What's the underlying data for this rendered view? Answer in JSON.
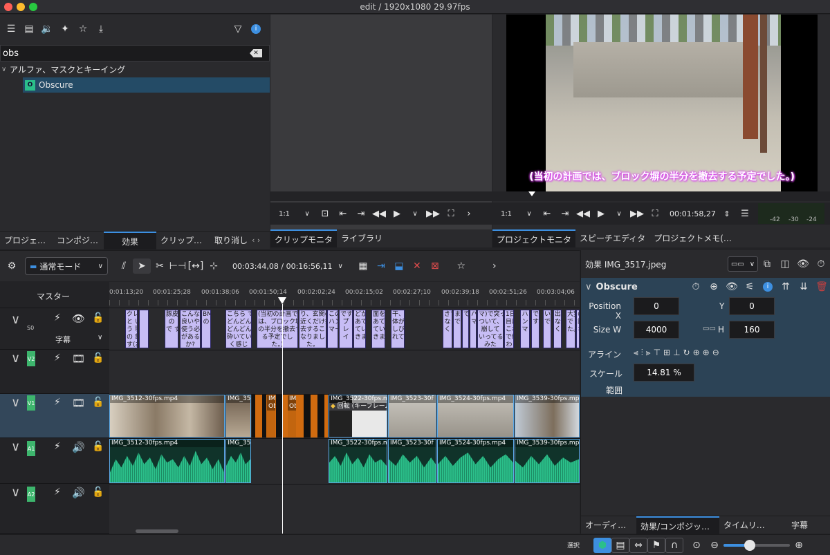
{
  "window": {
    "title": "edit / 1920x1080 29.97fps"
  },
  "effects": {
    "search_value": "obs",
    "category": "アルファ、マスクとキーイング",
    "item": "Obscure",
    "item_badge": "O"
  },
  "left_tabs": [
    "プロジェ…",
    "コンポジ…",
    "効果",
    "クリップ…",
    "取り消し"
  ],
  "monitor_tabs": [
    "クリップモニタ",
    "ライブラリ"
  ],
  "project_tabs": [
    "プロジェクトモニタ",
    "スピーチエディタ",
    "プロジェクトメモ(…"
  ],
  "clip_monitor": {
    "zoom": "1:1"
  },
  "project_monitor": {
    "zoom": "1:1",
    "timecode": "00:01:58,27",
    "subtitle": "(当初の計画では、ブロック塀の半分を撤去する予定でした。)",
    "meter_labels": [
      "-42",
      "-30",
      "-24"
    ]
  },
  "timeline_toolbar": {
    "mode": "通常モード",
    "timecode": "00:03:44,08 / 00:16:56,11"
  },
  "master_label": "マスター",
  "ruler": [
    "0:01:13;20",
    "00:01:25;28",
    "00:01:38;06",
    "00:01:50;14",
    "00:02:02;24",
    "00:02:15;02",
    "00:02:27;10",
    "00:02:39;18",
    "00:02:51;26",
    "00:03:04;06"
  ],
  "tracks": {
    "s0": {
      "tag": "S0",
      "sub_label": "字幕"
    },
    "v2": {
      "tag": "V2"
    },
    "v1": {
      "tag": "V1"
    },
    "a1": {
      "tag": "A1"
    },
    "a2": {
      "tag": "A2"
    }
  },
  "subtitle_clips": [
    "クレ\nと い\nう 現\nの 象\nす(お",
    "",
    "豚皮\nの\nで す",
    "こんな\n良いやつ\n使う必要\nがあるの\nか?",
    "BM\nの",
    "こちら で\nどんどん\nどんどん\n砕いてい\nく感じ",
    "(当初の計画で\nは、ブロック塀\nの半分を撤去す\nる予定でし\nた。)",
    "り、玄関の\n近くだけ撤\n去することに\nなりまし\nた。",
    "この\nハン\nマー",
    "です\nプ\nレ\nイ",
    "どか\nあて\nてい\nきま",
    "面を\nあて\nてい\nきま",
    "干、\n体が\nしび\nれて",
    "きて\nな\nく",
    "ま\nで",
    "で",
    "ハ\nマ",
    "マ)で突っ\nついて、\n崩して\nいってる\nみた",
    "1日\n目は\nこれ\nで終\nわ",
    "ハ\nン\nマ",
    "で\nす",
    "い\nで",
    "出\nな\nく",
    "大変\nでし\nた。",
    "ので、\n試\nさん"
  ],
  "video_clips": [
    "IMG_3512-30fps.mp4",
    "IMG_35",
    "IM\nOb",
    "IM\nOb",
    "IMG_3522-30fps.m",
    "IMG_3523-30f",
    "IMG_3524-30fps.mp4",
    "IMG_3539-30fps.mp"
  ],
  "keyframe_label": "回転 (キーフレーム",
  "audio_clips": [
    "IMG_3512-30fps.mp4",
    "IMG_35",
    "IMG_3522-30fps.mp4",
    "IMG_3523-30f",
    "IMG_3524-30fps.mp4",
    "IMG_3539-30fps.mp4"
  ],
  "fx_panel": {
    "title": "効果 IMG_3517.jpeg",
    "effect_name": "Obscure",
    "pos_x_label": "Position X",
    "pos_x": "0",
    "y_label": "Y",
    "pos_y": "0",
    "size_w_label": "Size W",
    "size_w": "4000",
    "h_label": "H",
    "size_h": "160",
    "align_label": "アライン",
    "scale_label": "スケール",
    "scale_value": "14.81 %",
    "range_label": "範囲"
  },
  "right_tabs": [
    "オーディ…",
    "効果/コンポジッ…",
    "タイムリ…",
    "字幕"
  ],
  "statusbar": {
    "select_label": "選択"
  },
  "colors": {
    "accent": "#3d8fe0",
    "audio": "#2bbf8a",
    "subtitle": "#c7bdf5",
    "track_tag": "#3db56d",
    "subtitle_text": "#d946ef"
  }
}
